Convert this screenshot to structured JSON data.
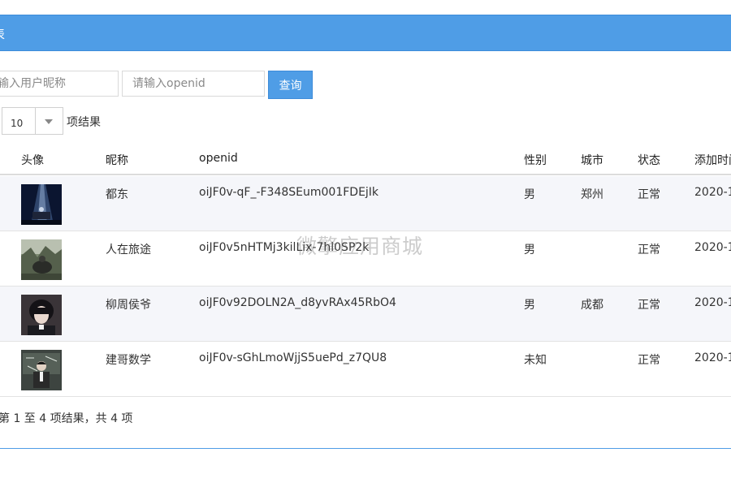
{
  "panel": {
    "title": "列表"
  },
  "search": {
    "nickname_placeholder": "请输入用户昵称",
    "openid_placeholder": "请输入openid",
    "query_label": "查询"
  },
  "length": {
    "value": "10",
    "label": "项结果"
  },
  "columns": {
    "avatar": "头像",
    "nickname": "昵称",
    "openid": "openid",
    "gender": "性别",
    "city": "城市",
    "status": "状态",
    "added": "添加时间"
  },
  "rows": [
    {
      "nickname": "都东",
      "openid": "oiJF0v-qF_-F348SEum001FDEjIk",
      "gender": "男",
      "city": "郑州",
      "status": "正常",
      "added": "2020-1"
    },
    {
      "nickname": "人在旅途",
      "openid": "oiJF0v5nHTMj3kilLix-7hl0SP2k",
      "gender": "男",
      "city": "",
      "status": "正常",
      "added": "2020-1"
    },
    {
      "nickname": "柳周侯爷",
      "openid": "oiJF0v92DOLN2A_d8yvRAx45RbO4",
      "gender": "男",
      "city": "成都",
      "status": "正常",
      "added": "2020-1"
    },
    {
      "nickname": "建哥数学",
      "openid": "oiJF0v-sGhLmoWjjS5uePd_z7QU8",
      "gender": "未知",
      "city": "",
      "status": "正常",
      "added": "2020-1"
    }
  ],
  "info": "第 1 至 4 项结果，共 4 项",
  "watermark": "微擎应用商城",
  "colors": {
    "primary": "#4f9de6",
    "stripe": "#f5f6fa"
  }
}
